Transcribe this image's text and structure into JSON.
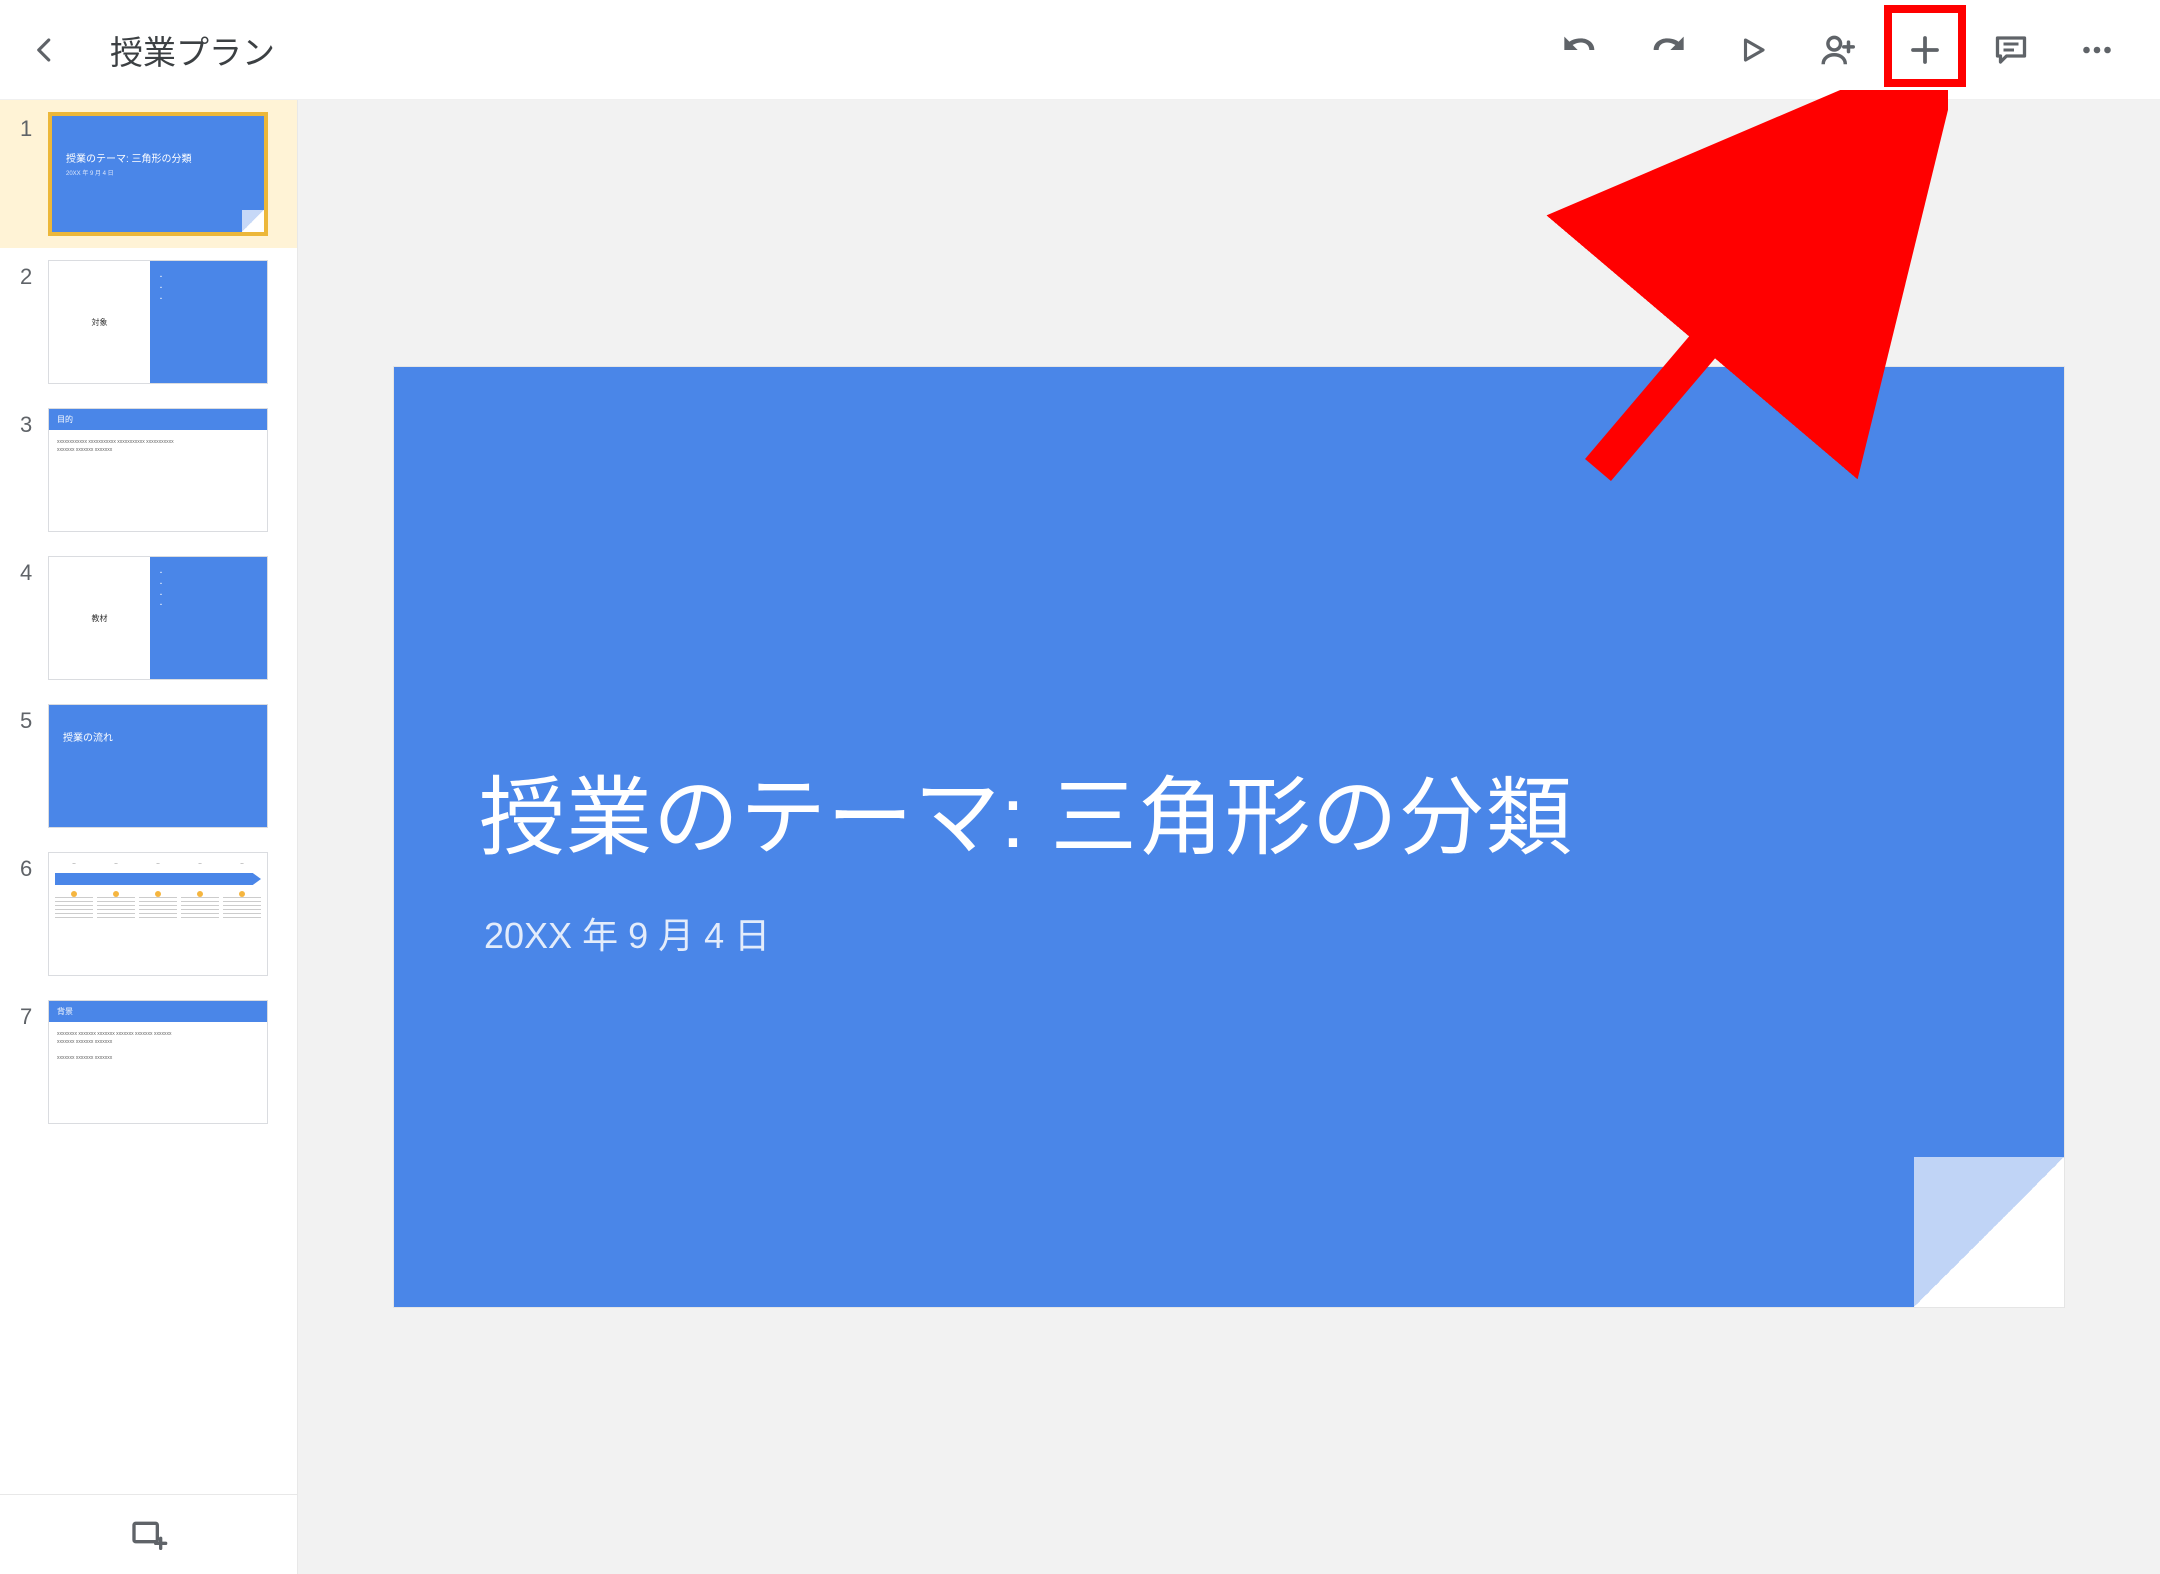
{
  "header": {
    "title": "授業プラン"
  },
  "toolbar_icons": {
    "back": "back-icon",
    "undo": "undo-icon",
    "redo": "redo-icon",
    "present": "present-icon",
    "share": "share-person-icon",
    "add": "plus-icon",
    "comment": "comment-icon",
    "more": "more-icon"
  },
  "slides": [
    {
      "num": "1",
      "layout": "title",
      "title": "授業のテーマ: 三角形の分類",
      "sub": "20XX 年 9 月 4 日",
      "selected": true
    },
    {
      "num": "2",
      "layout": "split",
      "left": "対象",
      "right": "・\n・\n・"
    },
    {
      "num": "3",
      "layout": "headbody",
      "head": "目的",
      "body": "xxxxxxxxxxxx xxxxxxxxxxx xxxxxxxxxxx xxxxxxxxxxx\nxxxxxxx xxxxxxx xxxxxxx"
    },
    {
      "num": "4",
      "layout": "split",
      "left": "教材",
      "right": "・\n・\n・\n・"
    },
    {
      "num": "5",
      "layout": "titleonly",
      "title": "授業の流れ"
    },
    {
      "num": "6",
      "layout": "timeline"
    },
    {
      "num": "7",
      "layout": "headbody",
      "head": "背景",
      "body": "xxxxxxxx xxxxxxx xxxxxxx xxxxxxx xxxxxxx xxxxxxx\nxxxxxxx xxxxxxx xxxxxxx\n\nxxxxxxx xxxxxxx xxxxxxx"
    }
  ],
  "main_slide": {
    "title": "授業のテーマ: 三角形の分類",
    "date": "20XX 年 9 月 4 日"
  },
  "colors": {
    "brand_blue": "#4a86e8",
    "highlight_red": "#ff0000",
    "selected_bg": "#fff3d6",
    "selected_border": "#ecb73a"
  }
}
